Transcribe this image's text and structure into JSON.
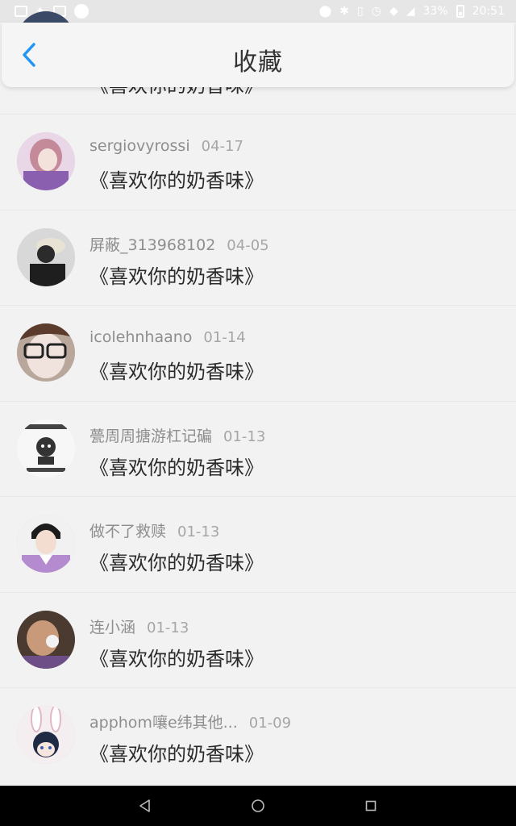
{
  "status_bar": {
    "battery": "33%",
    "time": "20:51"
  },
  "header": {
    "title": "收藏",
    "accent": "#2196F3"
  },
  "items": [
    {
      "user": "",
      "date": "",
      "song": "《喜欢你的奶香味》",
      "avatar": "avatar-partial"
    },
    {
      "user": "sergiovyrossi",
      "date": "04-17",
      "song": "《喜欢你的奶香味》",
      "avatar": "avatar-pink-anime"
    },
    {
      "user": "屏蔽_313968102",
      "date": "04-05",
      "song": "《喜欢你的奶香味》",
      "avatar": "avatar-hat-person"
    },
    {
      "user": "icolehnhaano",
      "date": "01-14",
      "song": "《喜欢你的奶香味》",
      "avatar": "avatar-glasses-girl"
    },
    {
      "user": "甍周周搪游杠记碥",
      "date": "01-13",
      "song": "《喜欢你的奶香味》",
      "avatar": "avatar-meme"
    },
    {
      "user": "做不了救赎",
      "date": "01-13",
      "song": "《喜欢你的奶香味》",
      "avatar": "avatar-boy-purple"
    },
    {
      "user": "连小涵",
      "date": "01-13",
      "song": "《喜欢你的奶香味》",
      "avatar": "avatar-drinking"
    },
    {
      "user": "apphom嚷e纬其他...",
      "date": "01-09",
      "song": "《喜欢你的奶香味》",
      "avatar": "avatar-bunny-boy"
    }
  ]
}
